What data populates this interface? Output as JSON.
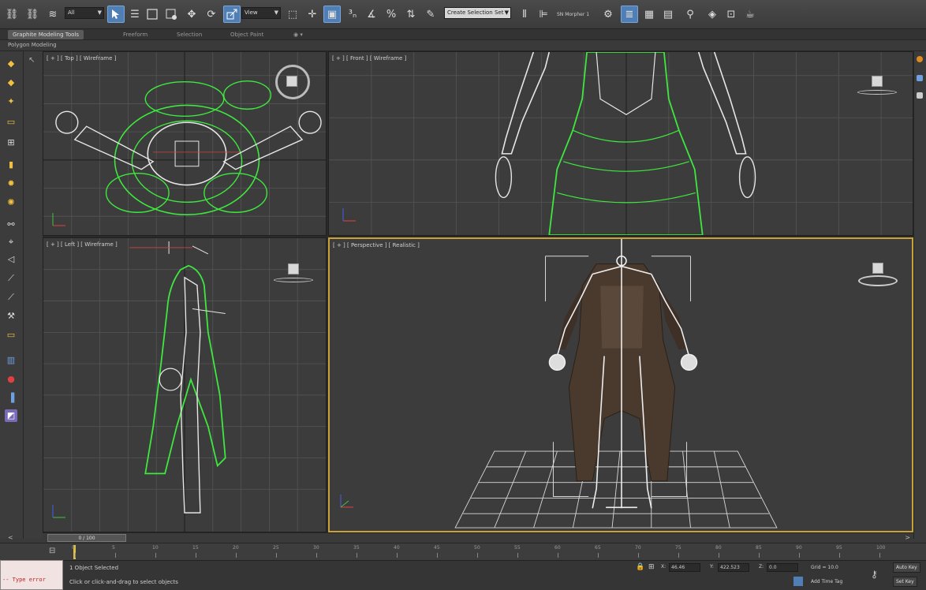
{
  "toolbar": {
    "selection_filter": "All",
    "reference_coord": "View",
    "named_selection": "Create Selection Set",
    "named_set_value": "SN Morpher 1"
  },
  "ribbon": {
    "tabs": [
      "Graphite Modeling Tools",
      "Freeform",
      "Selection",
      "Object Paint"
    ],
    "active_tab": 0,
    "panel_label": "Polygon Modeling"
  },
  "viewports": {
    "top": {
      "label": "[ + ] [ Top ] [ Wireframe ]"
    },
    "front": {
      "label": "[ + ] [ Front ] [ Wireframe ]"
    },
    "left": {
      "label": "[ + ] [ Left ] [ Wireframe ]"
    },
    "perspective": {
      "label": "[ + ] [ Perspective ] [ Realistic ]"
    }
  },
  "time_slider": {
    "label": "0 / 100"
  },
  "trackbar": {
    "ticks": [
      "0",
      "5",
      "10",
      "15",
      "20",
      "25",
      "30",
      "35",
      "40",
      "45",
      "50",
      "55",
      "60",
      "65",
      "70",
      "75",
      "80",
      "85",
      "90",
      "95",
      "100"
    ]
  },
  "status": {
    "selection_text": "1 Object Selected",
    "prompt_text": "Click or click-and-drag to select objects",
    "maxscript_error": "-- Type error",
    "x_value": "46.46",
    "y_value": "422.523",
    "z_value": "0.0",
    "grid_text": "Grid = 10.0",
    "add_time_tag": "Add Time Tag",
    "auto_key": "Auto Key",
    "set_key": "Set Key"
  },
  "colors": {
    "wireframe_green": "#3ee83e",
    "wireframe_white": "#e6e6e6",
    "active_border": "#c9a23a",
    "viewport_bg": "#3c3c3c",
    "toolbar_active": "#4f7fb5"
  }
}
